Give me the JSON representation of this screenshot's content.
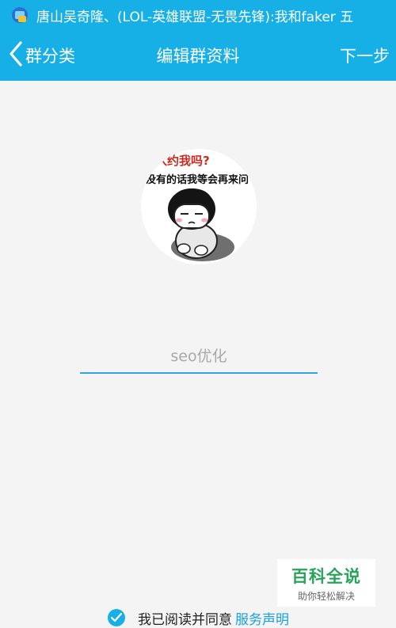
{
  "status_bar": {
    "notification_text": "唐山吴奇隆、(LOL-英雄联盟-无畏先锋):我和faker 五"
  },
  "nav": {
    "back_label": "群分类",
    "title": "编辑群资料",
    "next_label": "下一步"
  },
  "avatar": {
    "caption_line1": "入约我吗?",
    "caption_line2": "没有的话我等会再来问"
  },
  "group_name": {
    "value": "",
    "placeholder": "seo优化"
  },
  "agreement": {
    "text": "我已阅读并同意",
    "link": "服务声明",
    "checked": true
  },
  "watermark": {
    "title": "百科全说",
    "subtitle": "助你轻松解决"
  },
  "colors": {
    "accent": "#17b0e6",
    "background": "#f4f4f4",
    "field_underline": "#2fa5e2",
    "link": "#17a0e0",
    "watermark_green": "#27a35a"
  }
}
